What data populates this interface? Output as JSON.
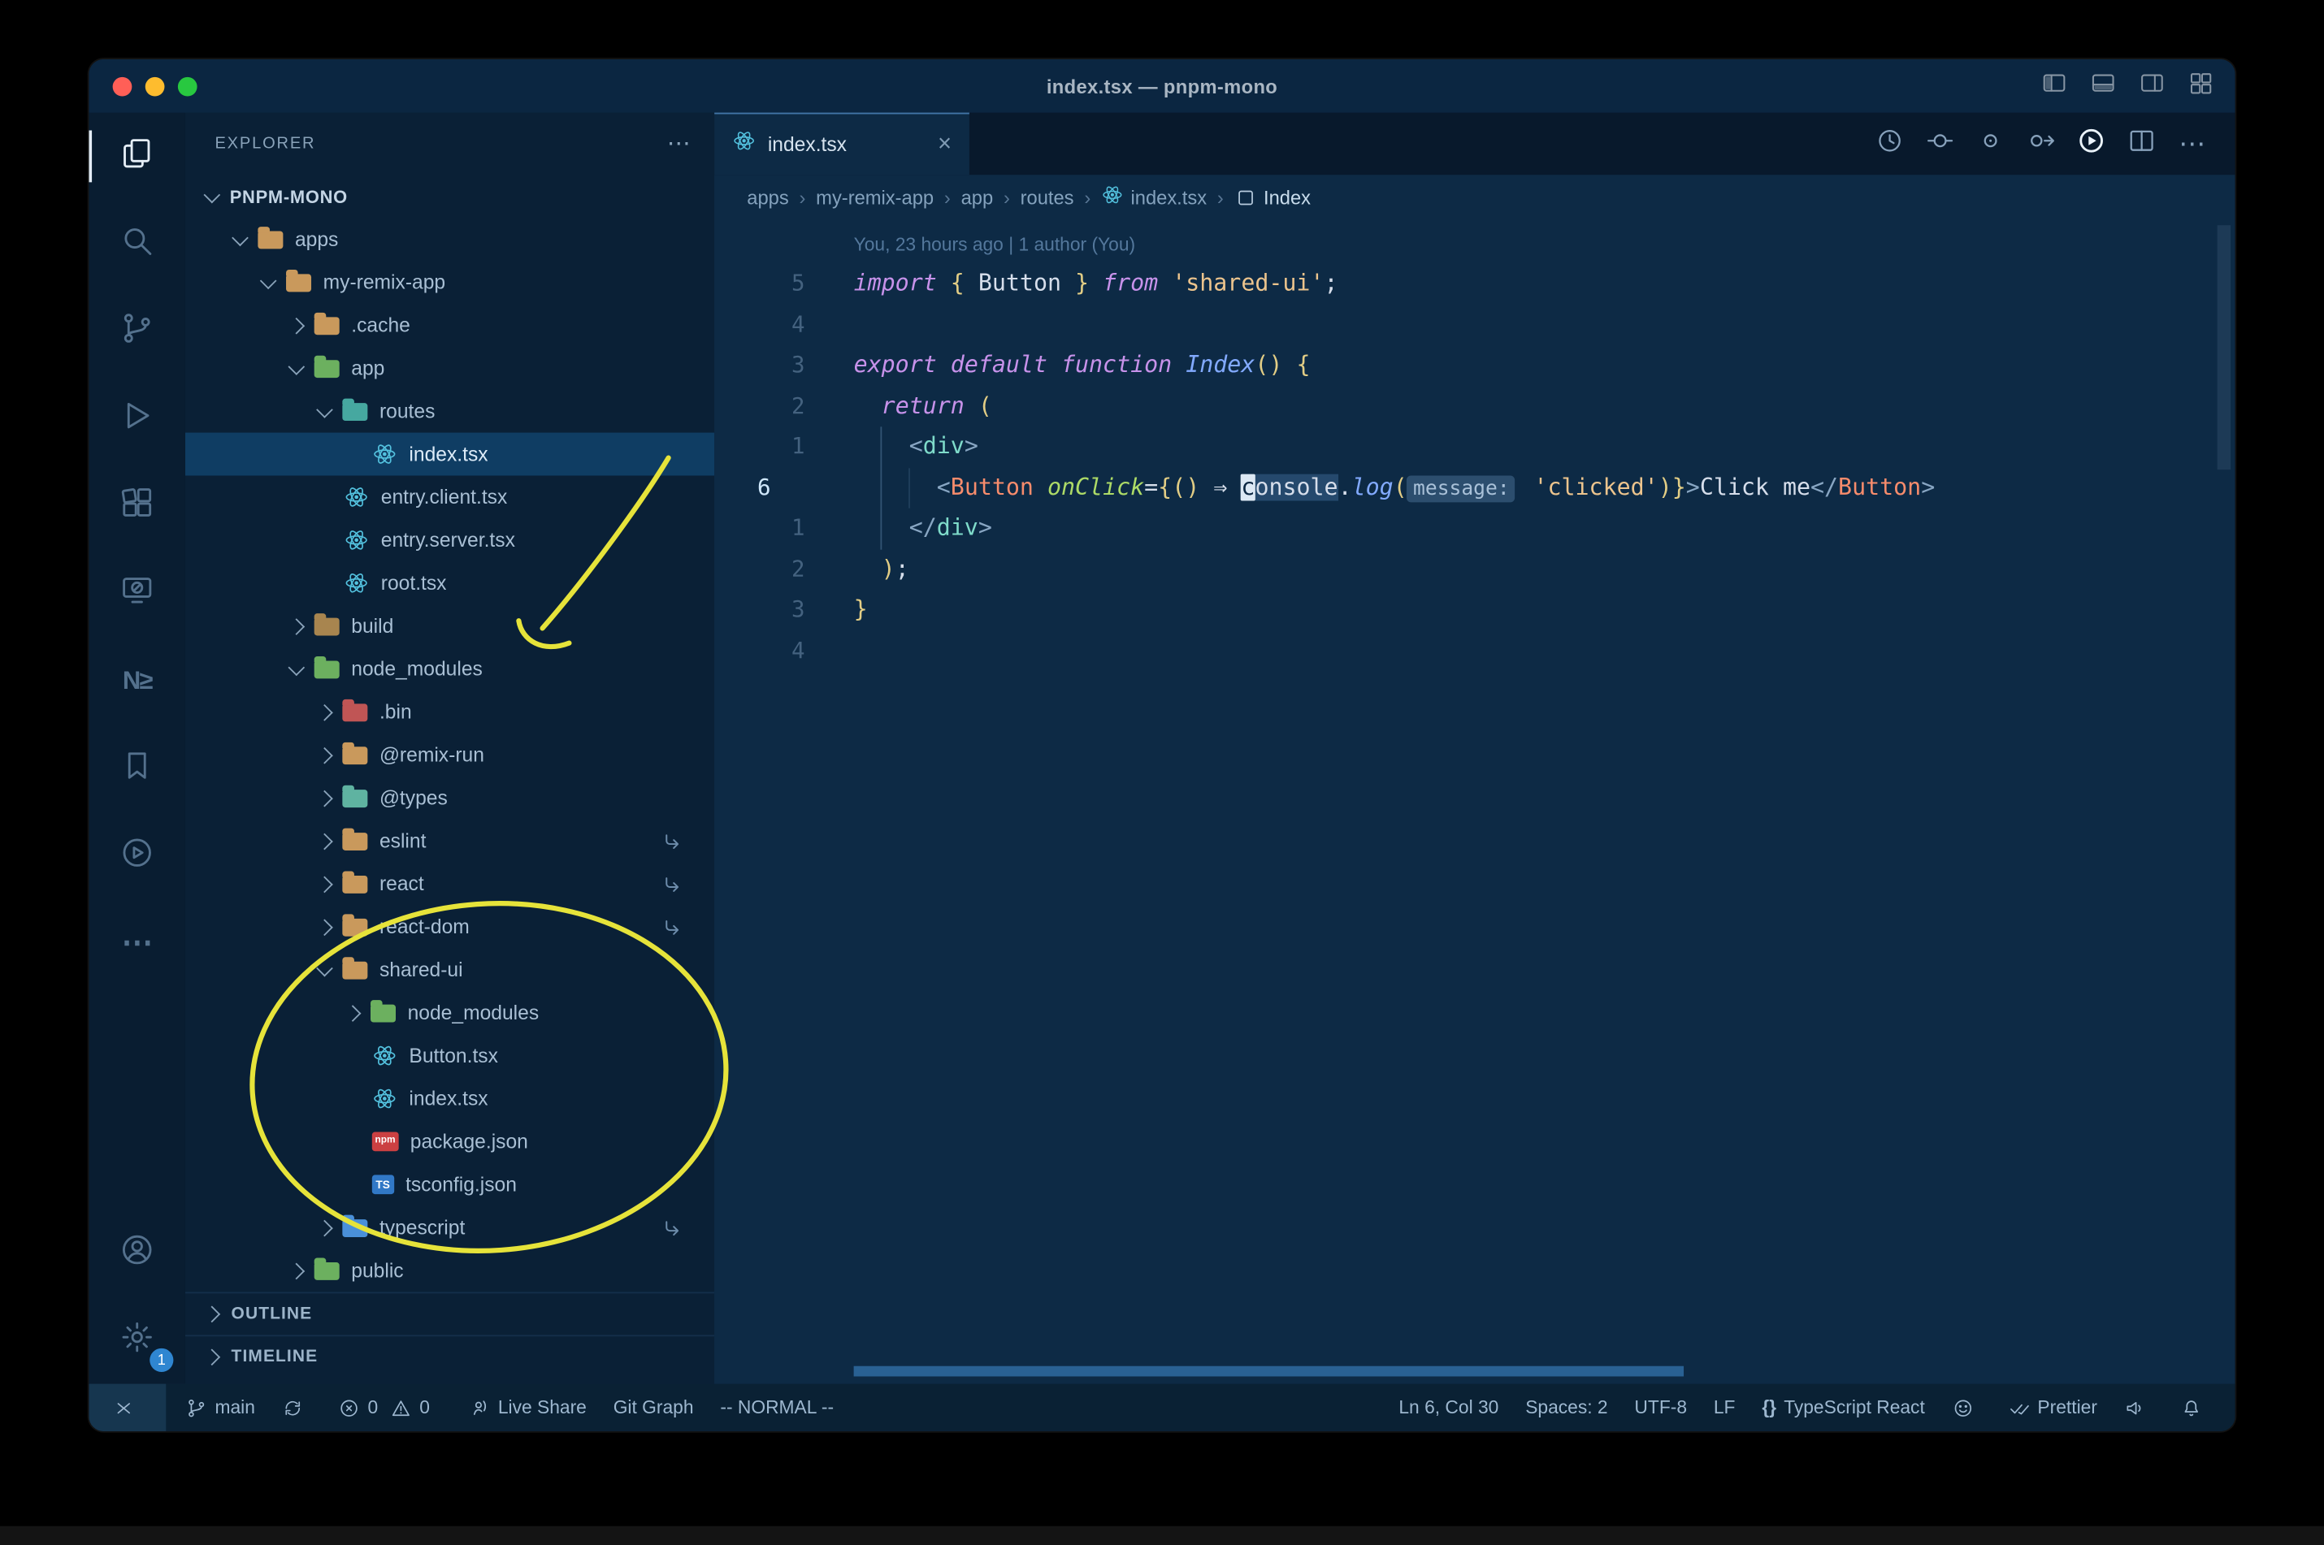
{
  "window_title": "index.tsx — pnpm-mono",
  "titlebar": {
    "layout_icons": [
      "toggle-sidebar-icon",
      "toggle-panel-icon",
      "toggle-secondary-sidebar-icon",
      "customize-layout-icon"
    ]
  },
  "activity_bar": {
    "items": [
      {
        "name": "explorer",
        "active": true
      },
      {
        "name": "search"
      },
      {
        "name": "source-control"
      },
      {
        "name": "run-and-debug"
      },
      {
        "name": "extensions"
      },
      {
        "name": "remote-explorer"
      },
      {
        "name": "nx-console",
        "glyph": "N≥"
      },
      {
        "name": "bookmarks"
      },
      {
        "name": "run"
      },
      {
        "name": "more-views",
        "glyph": "⋯"
      }
    ],
    "bottom": [
      {
        "name": "accounts"
      },
      {
        "name": "settings",
        "badge": "1"
      }
    ]
  },
  "explorer": {
    "title": "EXPLORER",
    "more": "⋯",
    "root": {
      "label": "PNPM-MONO"
    },
    "tree": [
      {
        "label": "apps",
        "level": 1,
        "kind": "folder",
        "color": "#c9995c",
        "expanded": true
      },
      {
        "label": "my-remix-app",
        "level": 2,
        "kind": "folder",
        "color": "#c9995c",
        "expanded": true
      },
      {
        "label": ".cache",
        "level": 3,
        "kind": "folder",
        "color": "#c9995c",
        "expanded": false
      },
      {
        "label": "app",
        "level": 3,
        "kind": "folder",
        "color": "#6cb05f",
        "expanded": true
      },
      {
        "label": "routes",
        "level": 4,
        "kind": "folder",
        "color": "#46a8a0",
        "expanded": true
      },
      {
        "label": "index.tsx",
        "level": 5,
        "kind": "file",
        "icon": "react",
        "selected": true
      },
      {
        "label": "entry.client.tsx",
        "level": 4,
        "kind": "file",
        "icon": "react"
      },
      {
        "label": "entry.server.tsx",
        "level": 4,
        "kind": "file",
        "icon": "react"
      },
      {
        "label": "root.tsx",
        "level": 4,
        "kind": "file",
        "icon": "react"
      },
      {
        "label": "build",
        "level": 3,
        "kind": "folder",
        "color": "#a8854f",
        "expanded": false
      },
      {
        "label": "node_modules",
        "level": 3,
        "kind": "folder",
        "color": "#6cb05f",
        "expanded": true
      },
      {
        "label": ".bin",
        "level": 4,
        "kind": "folder",
        "color": "#c05555",
        "expanded": false
      },
      {
        "label": "@remix-run",
        "level": 4,
        "kind": "folder",
        "color": "#c9995c",
        "expanded": false
      },
      {
        "label": "@types",
        "level": 4,
        "kind": "folder",
        "color": "#5fb3a1",
        "expanded": false
      },
      {
        "label": "eslint",
        "level": 4,
        "kind": "folder",
        "color": "#c9995c",
        "expanded": false,
        "symlink": true
      },
      {
        "label": "react",
        "level": 4,
        "kind": "folder",
        "color": "#c9995c",
        "expanded": false,
        "symlink": true
      },
      {
        "label": "react-dom",
        "level": 4,
        "kind": "folder",
        "color": "#c9995c",
        "expanded": false,
        "symlink": true
      },
      {
        "label": "shared-ui",
        "level": 4,
        "kind": "folder",
        "color": "#c9995c",
        "expanded": true
      },
      {
        "label": "node_modules",
        "level": 5,
        "kind": "folder",
        "color": "#6cb05f",
        "expanded": false
      },
      {
        "label": "Button.tsx",
        "level": 5,
        "kind": "file",
        "icon": "react"
      },
      {
        "label": "index.tsx",
        "level": 5,
        "kind": "file",
        "icon": "react"
      },
      {
        "label": "package.json",
        "level": 5,
        "kind": "file",
        "icon": "npm"
      },
      {
        "label": "tsconfig.json",
        "level": 5,
        "kind": "file",
        "icon": "ts"
      },
      {
        "label": "typescript",
        "level": 4,
        "kind": "folder",
        "color": "#4a90d9",
        "expanded": false,
        "symlink": true
      },
      {
        "label": "public",
        "level": 3,
        "kind": "folder",
        "color": "#6cb05f",
        "expanded": false
      }
    ],
    "sections": [
      {
        "label": "OUTLINE"
      },
      {
        "label": "TIMELINE"
      }
    ],
    "icon_glyphs": {
      "npm": "npm",
      "ts": "TS"
    }
  },
  "tabs": [
    {
      "label": "index.tsx",
      "icon": "react",
      "active": true,
      "close_glyph": "×"
    }
  ],
  "editor_actions": [
    {
      "name": "history"
    },
    {
      "name": "open-changes"
    },
    {
      "name": "open-revision"
    },
    {
      "name": "compare"
    },
    {
      "name": "run-code",
      "emphasis": true
    },
    {
      "name": "split-editor"
    },
    {
      "name": "more-actions",
      "glyph": "⋯"
    }
  ],
  "breadcrumbs": {
    "separator": "›",
    "items": [
      {
        "label": "apps"
      },
      {
        "label": "my-remix-app"
      },
      {
        "label": "app"
      },
      {
        "label": "routes"
      },
      {
        "label": "index.tsx",
        "icon": "react"
      },
      {
        "label": "Index",
        "icon": "symbol"
      }
    ]
  },
  "editor": {
    "blame": "You, 23 hours ago | 1 author (You)",
    "line_numbers": [
      "5",
      "4",
      "3",
      "2",
      "1",
      "6",
      "1",
      "2",
      "3",
      "4"
    ],
    "current_line": 5,
    "cursor_text": "c",
    "lines": [
      [
        [
          "k",
          "import"
        ],
        [
          "t",
          " "
        ],
        [
          "b",
          "{"
        ],
        [
          "t",
          " Button "
        ],
        [
          "b",
          "}"
        ],
        [
          "t",
          " "
        ],
        [
          "k",
          "from"
        ],
        [
          "t",
          " "
        ],
        [
          "s",
          "'shared-ui'"
        ],
        [
          "t",
          ";"
        ]
      ],
      [],
      [
        [
          "k",
          "export"
        ],
        [
          "t",
          " "
        ],
        [
          "k",
          "default"
        ],
        [
          "t",
          " "
        ],
        [
          "k",
          "function"
        ],
        [
          "t",
          " "
        ],
        [
          "f",
          "Index"
        ],
        [
          "b",
          "()"
        ],
        [
          "t",
          " "
        ],
        [
          "b",
          "{"
        ]
      ],
      [
        [
          "t",
          "  "
        ],
        [
          "k",
          "return"
        ],
        [
          "t",
          " "
        ],
        [
          "b",
          "("
        ]
      ],
      [
        [
          "t",
          "    "
        ],
        [
          "p",
          "<"
        ],
        [
          "g",
          "div"
        ],
        [
          "p",
          ">"
        ]
      ],
      [
        [
          "t",
          "      "
        ],
        [
          "p",
          "<"
        ],
        [
          "C",
          "Button"
        ],
        [
          "t",
          " "
        ],
        [
          "a",
          "onClick"
        ],
        [
          "o",
          "="
        ],
        [
          "b",
          "{"
        ],
        [
          "b",
          "()"
        ],
        [
          "t",
          " "
        ],
        [
          "o",
          "⇒"
        ],
        [
          "t",
          " "
        ],
        [
          "cur",
          "c"
        ],
        [
          "hl",
          "onsole"
        ],
        [
          "t",
          "."
        ],
        [
          "f",
          "log"
        ],
        [
          "b",
          "("
        ],
        [
          "in",
          "message:"
        ],
        [
          "t",
          " "
        ],
        [
          "s",
          "'clicked'"
        ],
        [
          "b",
          ")"
        ],
        [
          "b",
          "}"
        ],
        [
          "p",
          ">"
        ],
        [
          "t",
          "Click me"
        ],
        [
          "p",
          "</"
        ],
        [
          "C",
          "Button"
        ],
        [
          "p",
          ">"
        ]
      ],
      [
        [
          "t",
          "    "
        ],
        [
          "p",
          "</"
        ],
        [
          "g",
          "div"
        ],
        [
          "p",
          ">"
        ]
      ],
      [
        [
          "t",
          "  "
        ],
        [
          "b",
          ")"
        ],
        [
          "t",
          ";"
        ]
      ],
      [
        [
          "b",
          "}"
        ]
      ],
      []
    ]
  },
  "status_bar": {
    "left": [
      {
        "name": "remote",
        "icon": "remote"
      },
      {
        "name": "branch",
        "icon": "branch",
        "label": "main"
      },
      {
        "name": "sync",
        "icon": "sync"
      },
      {
        "name": "problems",
        "parts": [
          [
            "error",
            "0"
          ],
          [
            "warning",
            "0"
          ]
        ]
      },
      {
        "name": "live-share",
        "icon": "liveshare",
        "label": "Live Share"
      },
      {
        "name": "git-graph",
        "label": "Git Graph"
      },
      {
        "name": "vim-mode",
        "label": "-- NORMAL --"
      }
    ],
    "right": [
      {
        "name": "cursor-position",
        "label": "Ln 6, Col 30"
      },
      {
        "name": "indentation",
        "label": "Spaces: 2"
      },
      {
        "name": "encoding",
        "label": "UTF-8"
      },
      {
        "name": "eol",
        "label": "LF"
      },
      {
        "name": "language-mode",
        "glyph": "{}",
        "label": "TypeScript React"
      },
      {
        "name": "extension-face",
        "icon": "smiley"
      },
      {
        "name": "prettier",
        "icon": "check",
        "label": "Prettier"
      },
      {
        "name": "feedback",
        "icon": "feedback"
      },
      {
        "name": "notifications",
        "icon": "bell"
      }
    ]
  },
  "annotations": {
    "color": "#e6e33a",
    "shapes": [
      "arrow-to-node-modules",
      "circle-around-shared-ui"
    ]
  }
}
